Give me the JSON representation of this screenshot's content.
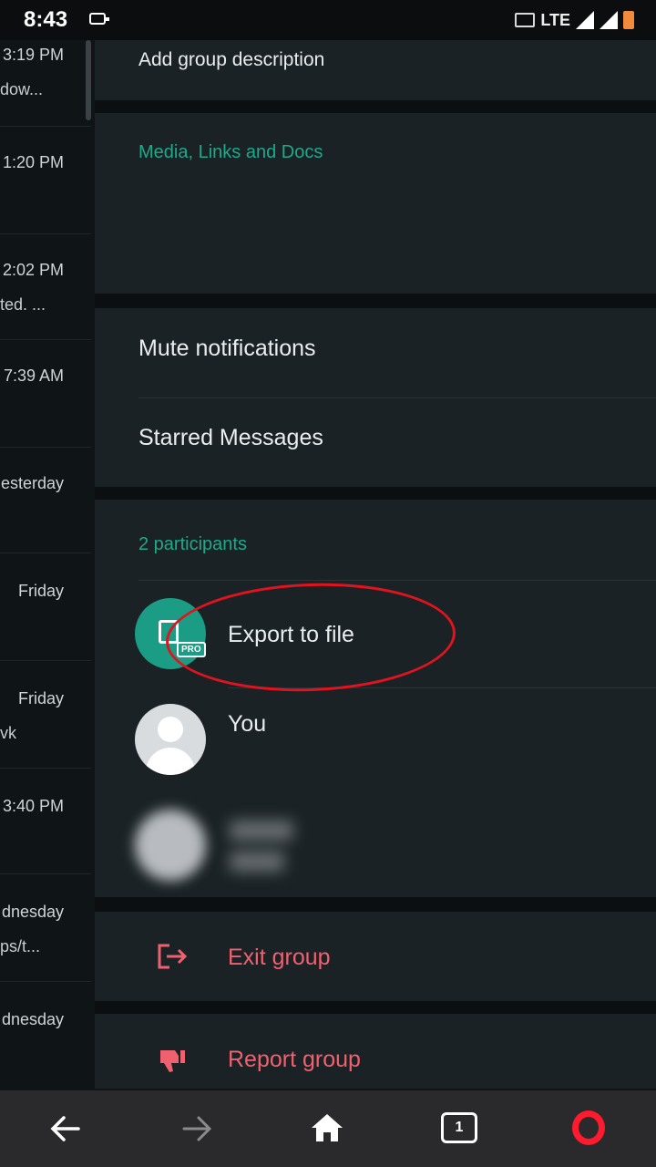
{
  "status_bar": {
    "time": "8:43",
    "network": "LTE"
  },
  "chat_list": [
    {
      "time": "3:19 PM",
      "preview": "dow..."
    },
    {
      "time": "1:20 PM",
      "preview": ""
    },
    {
      "time": "2:02 PM",
      "preview": "ted. ..."
    },
    {
      "time": "7:39 AM",
      "preview": ""
    },
    {
      "time": "esterday",
      "preview": ""
    },
    {
      "time": "Friday",
      "preview": ""
    },
    {
      "time": "Friday",
      "preview": "vk"
    },
    {
      "time": "3:40 PM",
      "preview": ""
    },
    {
      "time": "dnesday",
      "preview": "ps/t..."
    },
    {
      "time": "dnesday",
      "preview": ""
    }
  ],
  "group_info": {
    "description": "Add group description",
    "media_title": "Media, Links and Docs",
    "mute_label": "Mute notifications",
    "starred_label": "Starred Messages",
    "participants_title": "2 participants",
    "export_label": "Export to file",
    "export_badge": "PRO",
    "you_label": "You",
    "exit_label": "Exit group",
    "report_label": "Report group"
  },
  "bottom_nav": {
    "tabs_count": "1"
  },
  "colors": {
    "accent": "#1eaa8a",
    "danger": "#f0616f",
    "annotation": "#e0131f",
    "opera": "#ff1b2d"
  }
}
